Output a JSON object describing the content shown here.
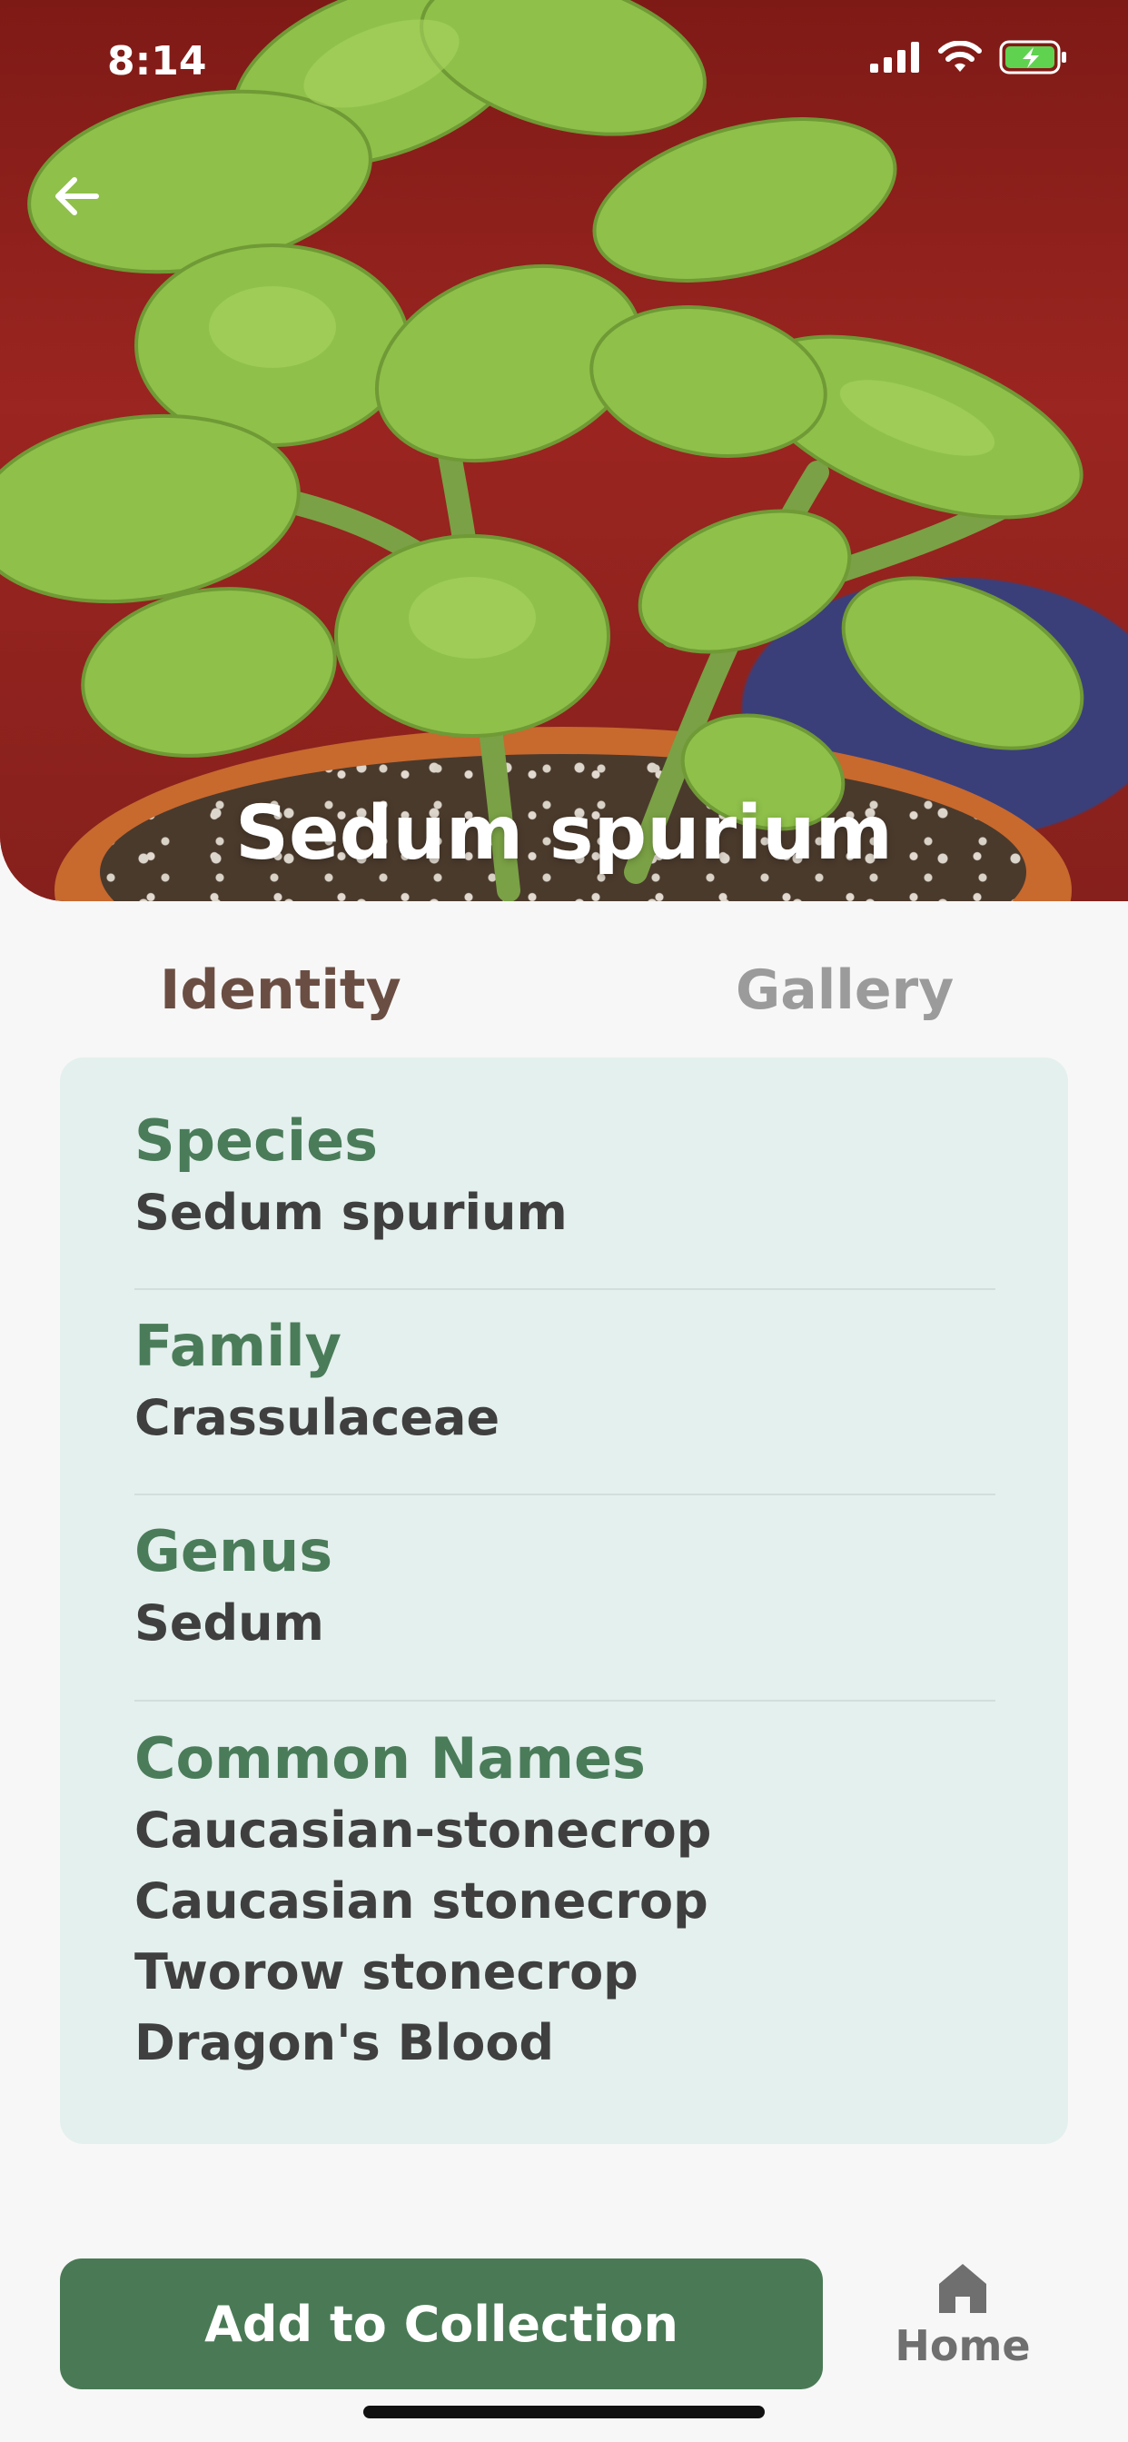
{
  "status_bar": {
    "time": "8:14"
  },
  "hero": {
    "title": "Sedum spurium"
  },
  "tabs": [
    {
      "label": "Identity",
      "active": true
    },
    {
      "label": "Gallery",
      "active": false
    }
  ],
  "identity": {
    "species": {
      "label": "Species",
      "value": "Sedum spurium"
    },
    "family": {
      "label": "Family",
      "value": "Crassulaceae"
    },
    "genus": {
      "label": "Genus",
      "value": "Sedum"
    },
    "common_names": {
      "label": "Common Names",
      "values": [
        "Caucasian-stonecrop",
        "Caucasian stonecrop",
        "Tworow stonecrop",
        "Dragon's Blood"
      ]
    }
  },
  "actions": {
    "add_label": "Add to Collection"
  },
  "nav": {
    "home_label": "Home"
  },
  "colors": {
    "accent": "#497a55",
    "label_green": "#4a7c5a",
    "active_tab": "#6b4e43",
    "card_bg": "#e4f0ed"
  }
}
